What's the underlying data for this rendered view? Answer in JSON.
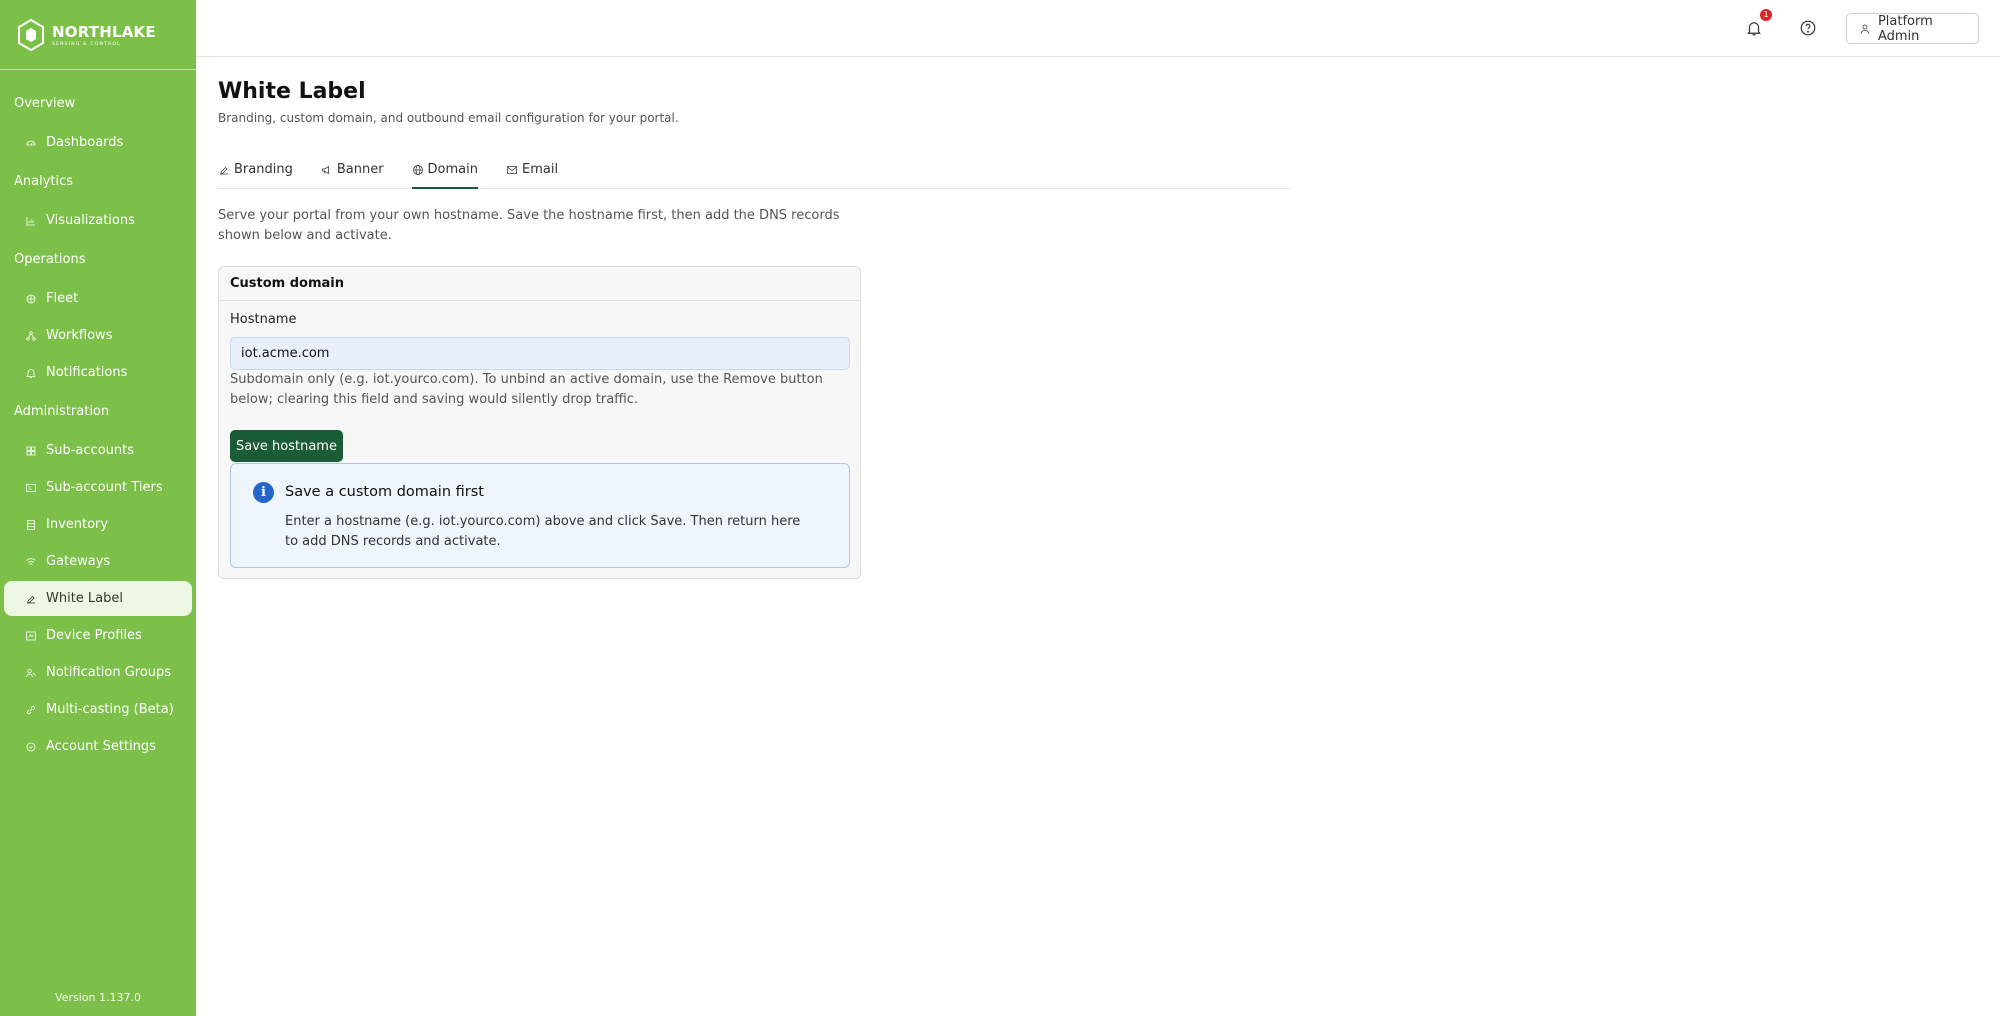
{
  "brand": {
    "name": "NORTHLAKE",
    "tagline": "SENSING & CONTROL"
  },
  "sidebar": {
    "sections": [
      {
        "label": "Overview",
        "items": [
          {
            "label": "Dashboards",
            "icon": "dashboard-icon"
          }
        ]
      },
      {
        "label": "Analytics",
        "items": [
          {
            "label": "Visualizations",
            "icon": "chart-icon"
          }
        ]
      },
      {
        "label": "Operations",
        "items": [
          {
            "label": "Fleet",
            "icon": "fleet-icon"
          },
          {
            "label": "Workflows",
            "icon": "workflow-icon"
          },
          {
            "label": "Notifications",
            "icon": "bell-icon"
          }
        ]
      },
      {
        "label": "Administration",
        "items": [
          {
            "label": "Sub-accounts",
            "icon": "grid-icon"
          },
          {
            "label": "Sub-account Tiers",
            "icon": "tiers-icon"
          },
          {
            "label": "Inventory",
            "icon": "inventory-icon"
          },
          {
            "label": "Gateways",
            "icon": "wifi-icon"
          },
          {
            "label": "White Label",
            "icon": "brush-icon",
            "active": true
          },
          {
            "label": "Device Profiles",
            "icon": "profile-icon"
          },
          {
            "label": "Notification Groups",
            "icon": "users-icon"
          },
          {
            "label": "Multi-casting (Beta)",
            "icon": "link-icon"
          },
          {
            "label": "Account Settings",
            "icon": "settings-icon"
          }
        ]
      }
    ],
    "version": "Version 1.137.0"
  },
  "topbar": {
    "notification_count": "1",
    "user_label": "Platform Admin"
  },
  "page": {
    "title": "White Label",
    "subtitle": "Branding, custom domain, and outbound email configuration for your portal.",
    "tabs": [
      {
        "label": "Branding",
        "icon": "brush-icon"
      },
      {
        "label": "Banner",
        "icon": "megaphone-icon"
      },
      {
        "label": "Domain",
        "icon": "globe-icon",
        "active": true
      },
      {
        "label": "Email",
        "icon": "mail-icon"
      }
    ],
    "intro": "Serve your portal from your own hostname. Save the hostname first, then add the DNS records shown below and activate."
  },
  "custom_domain": {
    "card_title": "Custom domain",
    "hostname_label": "Hostname",
    "hostname_value": "iot.acme.com",
    "help": "Subdomain only (e.g. iot.yourco.com). To unbind an active domain, use the Remove button below; clearing this field and saving would silently drop traffic.",
    "save_label": "Save hostname",
    "info": {
      "icon_glyph": "i",
      "title": "Save a custom domain first",
      "body": "Enter a hostname (e.g. iot.yourco.com) above and click Save. Then return here to add DNS records and activate."
    }
  }
}
